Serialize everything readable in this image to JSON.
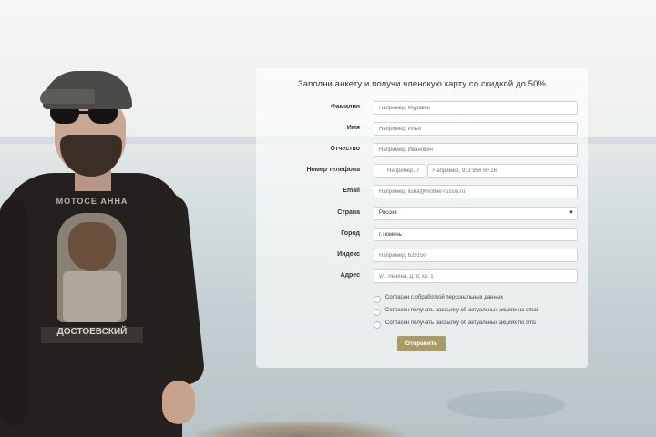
{
  "form": {
    "title": "Заполни анкету и получи членскую карту со скидкой до 50%",
    "fields": [
      {
        "label": "Фамилия",
        "placeholder": "Например, Муравей"
      },
      {
        "label": "Имя",
        "placeholder": "Например, Илья"
      },
      {
        "label": "Отчество",
        "placeholder": "Например, Иванович"
      },
      {
        "label": "Номер телефона",
        "code_placeholder": "Например, 7",
        "placeholder": "Например, 913 956 60 26"
      },
      {
        "label": "Email",
        "placeholder": "Например, iluha@mother-russia.ru"
      },
      {
        "label": "Страна",
        "value": "Россия"
      },
      {
        "label": "Город",
        "value": "г.Тюмень"
      },
      {
        "label": "Индекс",
        "placeholder": "Например, 629150"
      },
      {
        "label": "Адрес",
        "placeholder": "ул. Ленина, д. 9, кв. 1"
      }
    ],
    "checkboxes": [
      "Согласен с обработкой персональных данных",
      "Согласен получать рассылку об актуальных акциях на email",
      "Согласен получать рассылку об актуальных акциях по sms"
    ],
    "submit_label": "Отправить"
  },
  "photo": {
    "shirt_print_top": "МОТОСЕ АННА",
    "shirt_print_bottom": "ДОСТОЕВСКИЙ"
  },
  "icons": {
    "select_arrow": "caret-down-icon"
  }
}
